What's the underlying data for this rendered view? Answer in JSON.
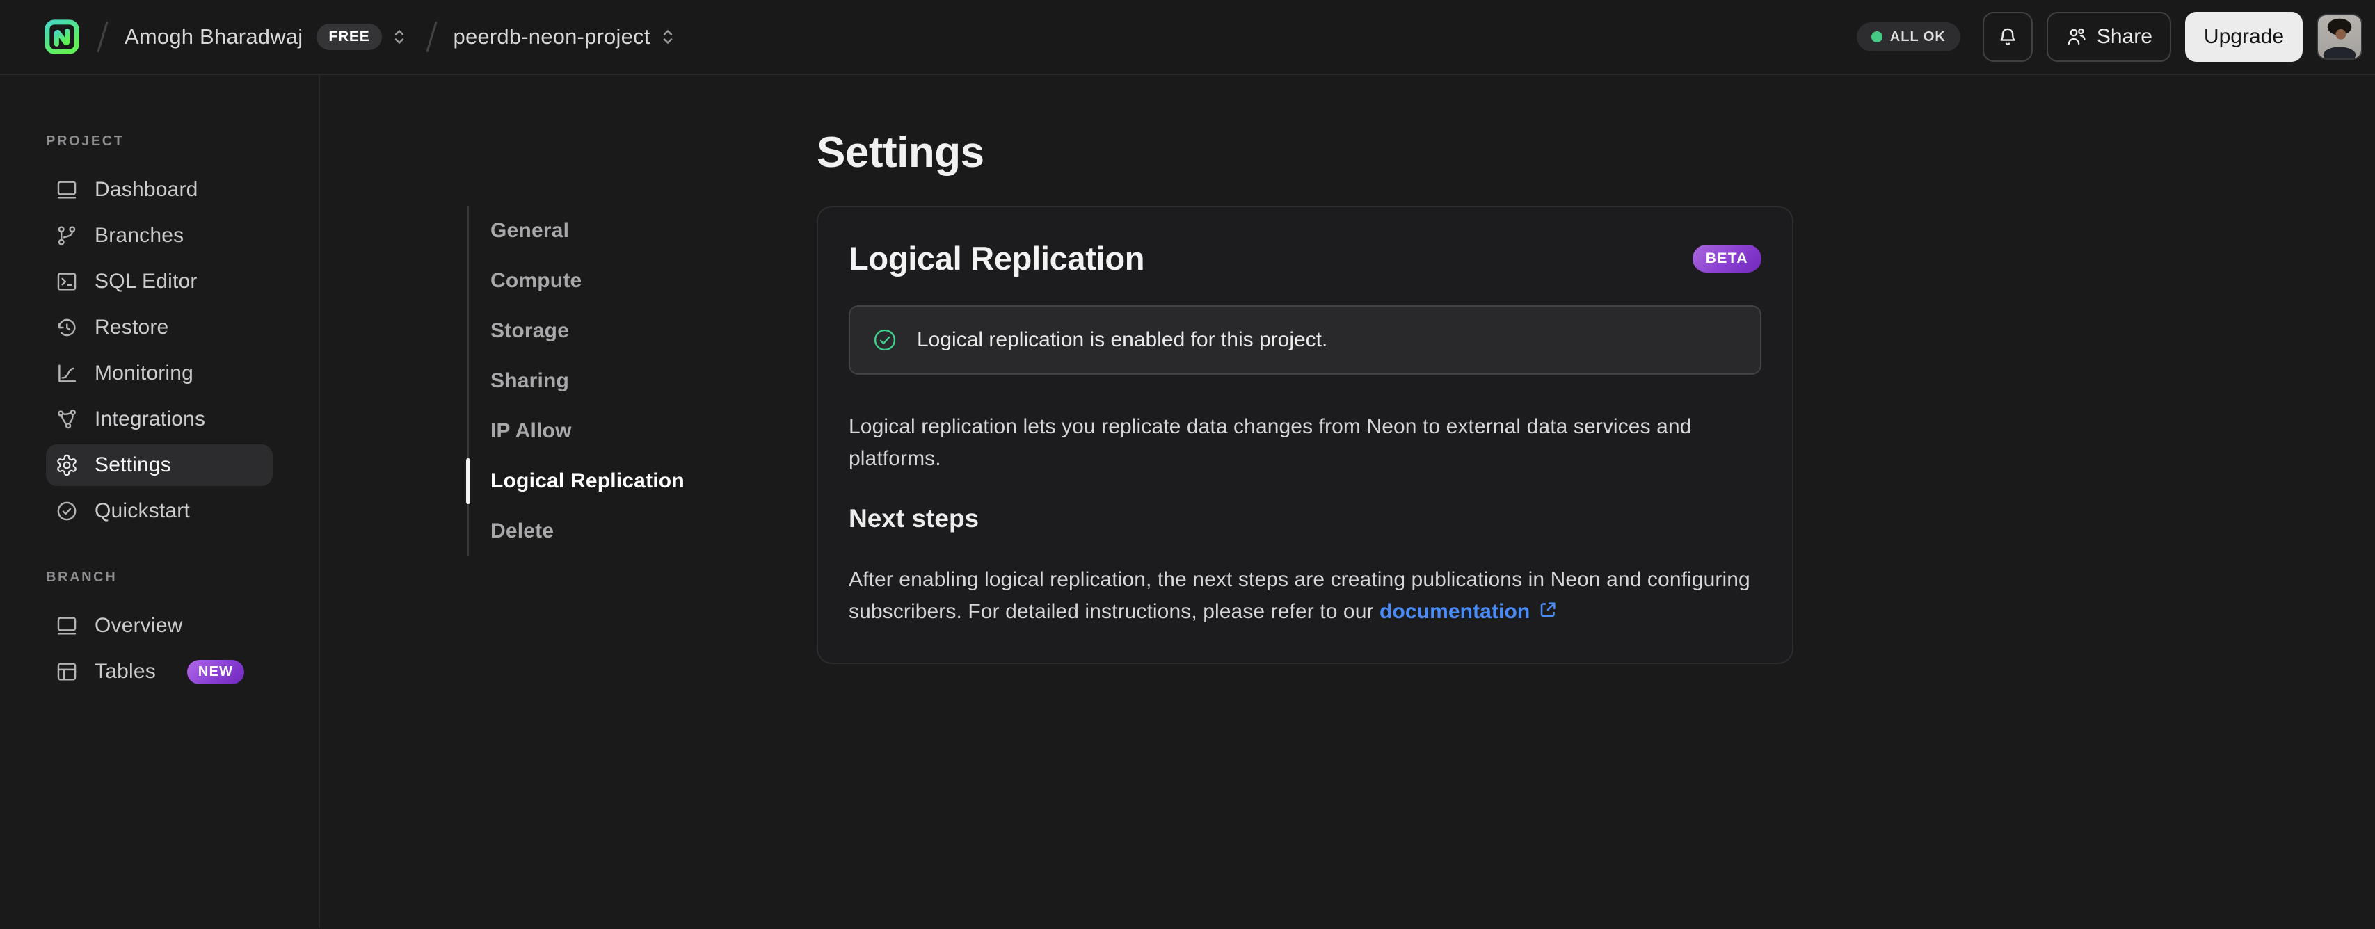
{
  "topbar": {
    "breadcrumb": {
      "org_name": "Amogh Bharadwaj",
      "plan_badge": "FREE",
      "project_name": "peerdb-neon-project"
    },
    "status_pill": "ALL OK",
    "share_label": "Share",
    "upgrade_label": "Upgrade"
  },
  "sidebar": {
    "sections": [
      {
        "label": "PROJECT",
        "items": [
          {
            "icon": "dashboard-icon",
            "label": "Dashboard"
          },
          {
            "icon": "branches-icon",
            "label": "Branches"
          },
          {
            "icon": "sql-editor-icon",
            "label": "SQL Editor"
          },
          {
            "icon": "restore-icon",
            "label": "Restore"
          },
          {
            "icon": "monitoring-icon",
            "label": "Monitoring"
          },
          {
            "icon": "integrations-icon",
            "label": "Integrations"
          },
          {
            "icon": "settings-icon",
            "label": "Settings",
            "active": true
          },
          {
            "icon": "quickstart-icon",
            "label": "Quickstart"
          }
        ]
      },
      {
        "label": "BRANCH",
        "items": [
          {
            "icon": "overview-icon",
            "label": "Overview"
          },
          {
            "icon": "tables-icon",
            "label": "Tables",
            "badge": "NEW"
          }
        ]
      }
    ]
  },
  "settings_nav": {
    "items": [
      "General",
      "Compute",
      "Storage",
      "Sharing",
      "IP Allow",
      "Logical Replication",
      "Delete"
    ],
    "active_item": "Logical Replication"
  },
  "main": {
    "page_title": "Settings",
    "card": {
      "title": "Logical Replication",
      "beta_badge": "BETA",
      "success_message": "Logical replication is enabled for this project.",
      "description": "Logical replication lets you replicate data changes from Neon to external data services and\nplatforms.",
      "next_steps_title": "Next steps",
      "next_steps_text_before_link": "After enabling logical replication, the next steps are creating publications in Neon and configuring\nsubscribers. For detailed instructions, please refer to our ",
      "link_text": "documentation"
    }
  },
  "colors": {
    "background": "#1a1a1b",
    "border": "#272728",
    "accent_green": "#3ecf8e",
    "status_dot_green": "#44ca85",
    "badge_purple": "#8a3fd4",
    "link_blue": "#4a8cf7",
    "upgrade_button_bg": "#ececec"
  }
}
